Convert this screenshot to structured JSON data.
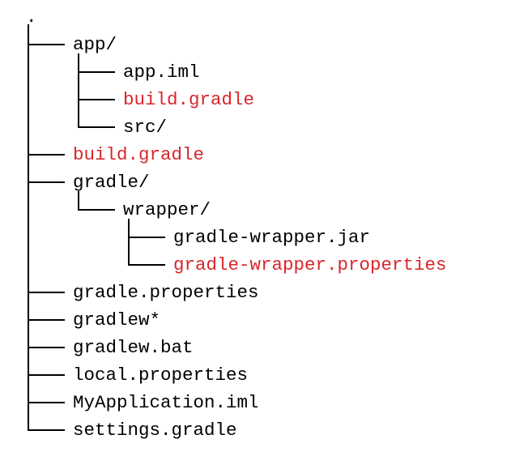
{
  "tree": {
    "root": ".",
    "nodes": [
      {
        "label": "app/",
        "depth": 0,
        "last": false,
        "highlight": false
      },
      {
        "label": "app.iml",
        "depth": 1,
        "last": false,
        "highlight": false
      },
      {
        "label": "build.gradle",
        "depth": 1,
        "last": false,
        "highlight": true
      },
      {
        "label": "src/",
        "depth": 1,
        "last": true,
        "highlight": false
      },
      {
        "label": "build.gradle",
        "depth": 0,
        "last": false,
        "highlight": true
      },
      {
        "label": "gradle/",
        "depth": 0,
        "last": false,
        "highlight": false
      },
      {
        "label": "wrapper/",
        "depth": 1,
        "last": true,
        "highlight": false
      },
      {
        "label": "gradle-wrapper.jar",
        "depth": 2,
        "last": false,
        "highlight": false
      },
      {
        "label": "gradle-wrapper.properties",
        "depth": 2,
        "last": true,
        "highlight": true
      },
      {
        "label": "gradle.properties",
        "depth": 0,
        "last": false,
        "highlight": false
      },
      {
        "label": "gradlew*",
        "depth": 0,
        "last": false,
        "highlight": false
      },
      {
        "label": "gradlew.bat",
        "depth": 0,
        "last": false,
        "highlight": false
      },
      {
        "label": "local.properties",
        "depth": 0,
        "last": false,
        "highlight": false
      },
      {
        "label": "MyApplication.iml",
        "depth": 0,
        "last": false,
        "highlight": false
      },
      {
        "label": "settings.gradle",
        "depth": 0,
        "last": true,
        "highlight": false
      }
    ]
  },
  "colors": {
    "text": "#000000",
    "highlight": "#d9262b",
    "background": "#ffffff"
  }
}
